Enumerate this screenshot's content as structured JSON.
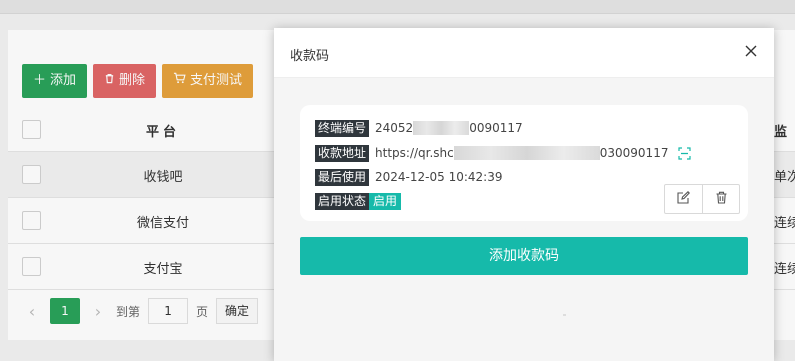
{
  "toolbar": {
    "add_label": "添加",
    "delete_label": "删除",
    "pay_test_label": "支付测试"
  },
  "table": {
    "header_platform": "平台",
    "header_right": "监",
    "rows": [
      {
        "platform": "收钱吧",
        "right": "单次"
      },
      {
        "platform": "微信支付",
        "right": "连续"
      },
      {
        "platform": "支付宝",
        "right": "连续"
      }
    ]
  },
  "pager": {
    "current_page": "1",
    "goto_prefix": "到第",
    "goto_value": "1",
    "goto_suffix": "页",
    "confirm_label": "确定"
  },
  "modal": {
    "title": "收款码",
    "close_glyph": "✕",
    "card": {
      "fields": [
        {
          "label": "终端编号",
          "value_prefix": "24052",
          "value_suffix": "0090117"
        },
        {
          "label": "收款地址",
          "value_prefix": "https://qr.shc",
          "value_suffix": "030090117"
        },
        {
          "label": "最后使用",
          "value": "2024-12-05 10:42:39"
        },
        {
          "label": "启用状态",
          "value": "启用"
        }
      ]
    },
    "add_button_label": "添加收款码"
  },
  "colors": {
    "green": "#2aa35a",
    "red": "#e06767",
    "orange": "#e6a23c",
    "teal": "#16baaa",
    "tag_dark": "#2f363c"
  },
  "icons": {
    "add": "plus-icon",
    "delete": "trash-icon",
    "pay_test": "cart-icon",
    "close": "close-icon",
    "scan": "scan-icon",
    "edit": "edit-icon",
    "remove": "trash-icon"
  }
}
